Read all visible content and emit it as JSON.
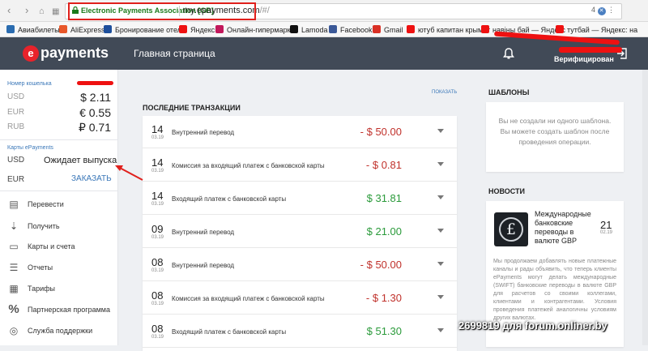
{
  "browser": {
    "back_icon": "back-arrow",
    "forward_icon": "forward-arrow",
    "apps_icon": "grid",
    "site_identity": "Electronic Payments Association [GB]",
    "url_host": "my.epayments.com",
    "url_path": "/#/",
    "ext_badge": "4"
  },
  "bookmarks": [
    {
      "label": "Авиабилеты",
      "color": "#2b6cb0"
    },
    {
      "label": "AliExpress",
      "color": "#e8572a"
    },
    {
      "label": "Бронирование отел",
      "color": "#1d4f9c"
    },
    {
      "label": "Яндекс",
      "color": "#e11"
    },
    {
      "label": "Онлайн-гипермарке",
      "color": "#c2185b"
    },
    {
      "label": "Lamoda",
      "color": "#111"
    },
    {
      "label": "Facebook",
      "color": "#3b5998"
    },
    {
      "label": "Gmail",
      "color": "#d93025"
    },
    {
      "label": "ютуб капитан крымат",
      "color": "#e11"
    },
    {
      "label": "навіны бай — Яндекс",
      "color": "#e11"
    },
    {
      "label": "тутбай — Яндекс: на",
      "color": "#e11"
    }
  ],
  "header": {
    "logo_mark": "e",
    "logo_text": "payments",
    "page_title": "Главная страница",
    "verified_label": "Верифицирован"
  },
  "wallet": {
    "label": "Номер кошелька",
    "balances": [
      {
        "code": "USD",
        "amount": "$ 2.11"
      },
      {
        "code": "EUR",
        "amount": "€ 0.55"
      },
      {
        "code": "RUB",
        "amount": "₽ 0.71"
      }
    ]
  },
  "card": {
    "label": "Карты ePayments",
    "currency": "USD",
    "status": "Ожидает выпуска",
    "currency2": "EUR",
    "order_label": "ЗАКАЗАТЬ"
  },
  "menu": [
    {
      "label": "Перевести",
      "icon": "transfer-icon",
      "glyph": "▤"
    },
    {
      "label": "Получить",
      "icon": "receive-icon",
      "glyph": "⇣"
    },
    {
      "label": "Карты и счета",
      "icon": "cards-icon",
      "glyph": "▭"
    },
    {
      "label": "Отчеты",
      "icon": "reports-icon",
      "glyph": "☰"
    },
    {
      "label": "Тарифы",
      "icon": "tariffs-icon",
      "glyph": "▦"
    },
    {
      "label": "Партнерская программа",
      "icon": "percent-icon",
      "glyph": "%"
    },
    {
      "label": "Служба поддержки",
      "icon": "support-icon",
      "glyph": "◎"
    }
  ],
  "transactions": {
    "heading": "Последние транзакции",
    "show_label": "Показать",
    "items": [
      {
        "day": "14",
        "month": "03.19",
        "desc": "Внутренний перевод",
        "amount": "- $ 50.00",
        "sign": "neg"
      },
      {
        "day": "14",
        "month": "03.19",
        "desc": "Комиссия за входящий платеж с банковской карты",
        "amount": "- $ 0.81",
        "sign": "neg"
      },
      {
        "day": "14",
        "month": "03.19",
        "desc": "Входящий платеж с банковской карты",
        "amount": "$ 31.81",
        "sign": "pos"
      },
      {
        "day": "09",
        "month": "03.19",
        "desc": "Внутренний перевод",
        "amount": "$ 21.00",
        "sign": "pos"
      },
      {
        "day": "08",
        "month": "03.19",
        "desc": "Внутренний перевод",
        "amount": "- $ 50.00",
        "sign": "neg"
      },
      {
        "day": "08",
        "month": "03.19",
        "desc": "Комиссия за входящий платеж с банковской карты",
        "amount": "- $ 1.30",
        "sign": "neg"
      },
      {
        "day": "08",
        "month": "03.19",
        "desc": "Входящий платеж с банковской карты",
        "amount": "$ 51.30",
        "sign": "pos"
      }
    ]
  },
  "templates": {
    "heading": "Шаблоны",
    "empty_text": "Вы не создали ни одного шаблона. Вы можете создать шаблон после проведения операции."
  },
  "news": {
    "heading": "Новости",
    "title": "Международные банковские переводы в валюте GBP",
    "day": "21",
    "month": "02.19",
    "image_glyph": "£",
    "body": "Мы продолжаем добавлять новые платежные каналы и рады объявить, что теперь клиенты ePayments могут делать международные (SWIFT) банковские переводы в валюте GBP для расчетов со своими коллегами, клиентами и контрагентами. Условия проведения платежей аналогичны условиям других валютах."
  },
  "watermark": "2699819 для forum.onliner.by",
  "colors": {
    "header_bg": "#414a57",
    "accent": "#3a77b8",
    "negative": "#c0312b",
    "positive": "#2a9a3a",
    "brand_red": "#e8232b"
  }
}
